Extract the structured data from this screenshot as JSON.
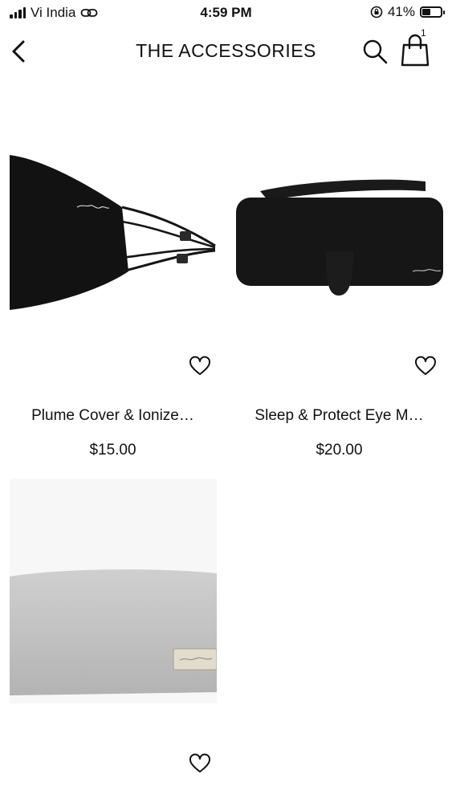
{
  "status_bar": {
    "carrier": "Vi India",
    "time": "4:59 PM",
    "battery": "41%"
  },
  "header": {
    "title": "THE ACCESSORIES",
    "cart_count": "1"
  },
  "products": [
    {
      "name": "Plume Cover & Ionize…",
      "price": "$15.00"
    },
    {
      "name": "Sleep & Protect Eye M…",
      "price": "$20.00"
    },
    {
      "name": "",
      "price": ""
    }
  ]
}
